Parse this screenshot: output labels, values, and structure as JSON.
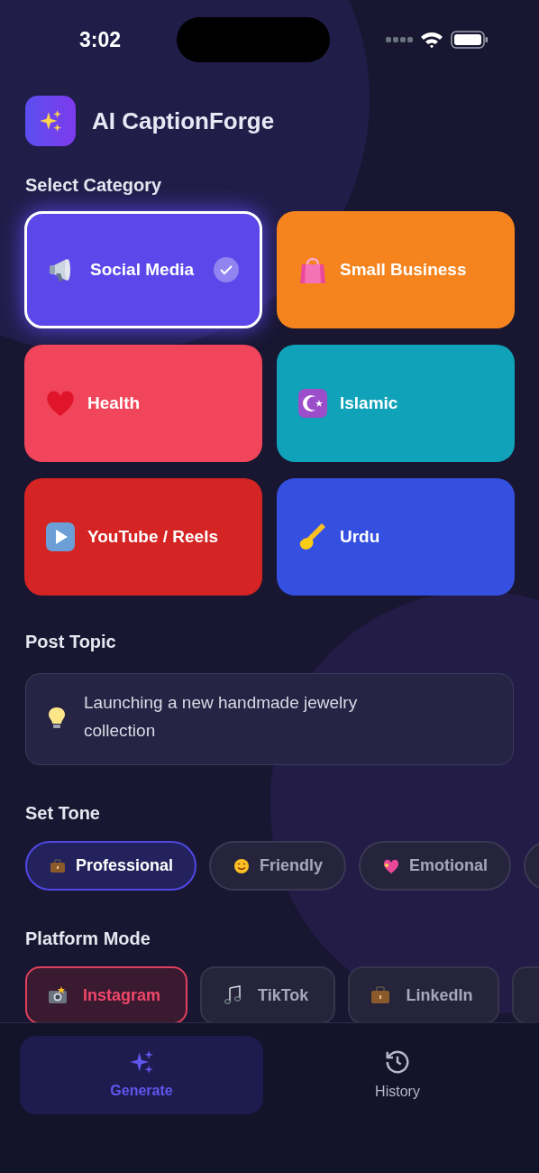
{
  "status_bar": {
    "time": "3:02"
  },
  "header": {
    "title": "AI CaptionForge"
  },
  "category_section": {
    "title": "Select Category",
    "items": [
      {
        "label": "Social Media",
        "selected": true,
        "color": "#5b47ea"
      },
      {
        "label": "Small Business",
        "selected": false,
        "color": "#f5841e"
      },
      {
        "label": "Health",
        "selected": false,
        "color": "#f0455a"
      },
      {
        "label": "Islamic",
        "selected": false,
        "color": "#0fa2b8"
      },
      {
        "label": "YouTube / Reels",
        "selected": false,
        "color": "#d42424"
      },
      {
        "label": "Urdu",
        "selected": false,
        "color": "#3550e0"
      }
    ]
  },
  "topic_section": {
    "title": "Post Topic",
    "value": "Launching a new handmade jewelry collection"
  },
  "tone_section": {
    "title": "Set Tone",
    "items": [
      {
        "label": "Professional",
        "selected": true
      },
      {
        "label": "Friendly",
        "selected": false
      },
      {
        "label": "Emotional",
        "selected": false
      }
    ]
  },
  "platform_section": {
    "title": "Platform Mode",
    "items": [
      {
        "label": "Instagram",
        "selected": true
      },
      {
        "label": "TikTok",
        "selected": false
      },
      {
        "label": "LinkedIn",
        "selected": false
      }
    ]
  },
  "bottom_nav": {
    "items": [
      {
        "label": "Generate",
        "selected": true
      },
      {
        "label": "History",
        "selected": false
      }
    ]
  }
}
